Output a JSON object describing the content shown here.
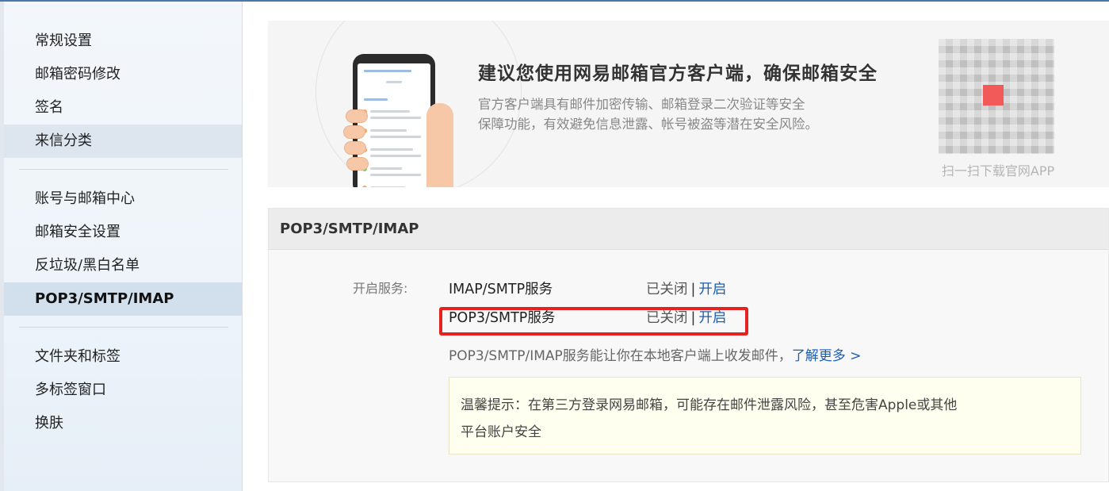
{
  "sidebar": {
    "items_top": [
      {
        "label": "常规设置"
      },
      {
        "label": "邮箱密码修改"
      },
      {
        "label": "签名"
      },
      {
        "label": "来信分类"
      }
    ],
    "items_mid": [
      {
        "label": "账号与邮箱中心"
      },
      {
        "label": "邮箱安全设置"
      },
      {
        "label": "反垃圾/黑白名单"
      },
      {
        "label": "POP3/SMTP/IMAP"
      }
    ],
    "items_bottom": [
      {
        "label": "文件夹和标签"
      },
      {
        "label": "多标签窗口"
      },
      {
        "label": "换肤"
      }
    ],
    "active": "POP3/SMTP/IMAP"
  },
  "banner": {
    "title": "建议您使用网易邮箱官方客户端，确保邮箱安全",
    "desc_line1": "官方客户端具有邮件加密传输、邮箱登录二次验证等安全",
    "desc_line2": "保障功能，有效避免信息泄露、帐号被盗等潜在安全风险。",
    "qr_label": "扫一扫下载官网APP",
    "qr_accent": "#f25a5a"
  },
  "section": {
    "title": "POP3/SMTP/IMAP",
    "field_label": "开启服务:",
    "services": [
      {
        "name": "IMAP/SMTP服务",
        "status": "已关闭",
        "separator": "|",
        "action": "开启"
      },
      {
        "name": "POP3/SMTP服务",
        "status": "已关闭",
        "separator": "|",
        "action": "开启"
      }
    ],
    "info": "POP3/SMTP/IMAP服务能让你在本地客户端上收发邮件，",
    "learn_more": "了解更多 >",
    "tip_line1": "温馨提示：在第三方登录网易邮箱，可能存在邮件泄露风险，甚至危害Apple或其他",
    "tip_line2": "平台账户安全"
  },
  "colors": {
    "link": "#1a5fb4",
    "highlight_border": "#e3231f",
    "sidebar_active": "#d2dfec"
  }
}
